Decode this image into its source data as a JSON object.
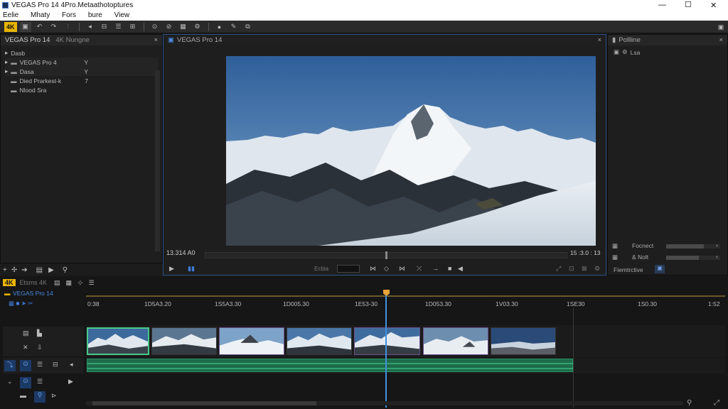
{
  "window": {
    "title": "VEGAS Pro 14  4Pro.Metaathotoptures",
    "controls": {
      "minimize": "—",
      "maximize": "☐",
      "close": "✕"
    }
  },
  "menu": [
    "Eelie",
    "Mhaty",
    "Fors",
    "bure",
    "View"
  ],
  "toolbar": {
    "badge_4k": "4K"
  },
  "explorer": {
    "tabs": [
      "VEGAS Pro 14",
      "4K Nungne"
    ],
    "close": "×",
    "root": "Dasb",
    "items": [
      {
        "label": "VEGAS Pro 4",
        "mark": "Y"
      },
      {
        "label": "Dasa",
        "mark": "Y"
      },
      {
        "label": "Died Prarkest-k",
        "mark": "7"
      },
      {
        "label": "Nlood Sra",
        "mark": ""
      }
    ]
  },
  "preview": {
    "title": "VEGAS Pro 14",
    "close": "×",
    "time_left": "13.314 A0",
    "time_right": "15 :3.0 : 13",
    "mode_label": "Ecbia"
  },
  "properties": {
    "title": "Pollline",
    "close": "×",
    "item": "Lsa",
    "sliders": [
      {
        "label": "Focnect",
        "value": 0.7
      },
      {
        "label": "& Nolt",
        "value": 0.6
      }
    ],
    "footer_label": "Fiemtrctive"
  },
  "timeline": {
    "badge_4k": "4K",
    "toolbar_label": "Etsms 4K",
    "project_label": "VEGAS Pro 14",
    "ruler": [
      "0:38",
      "1D5A3.20",
      "1S5A3.30",
      "1D005.30",
      "1E53-30",
      "1D053.30",
      "1V03.30",
      "1SE30",
      "1S0.30",
      "1:52"
    ],
    "playhead": 0.47,
    "clip_count": 7
  },
  "colors": {
    "accent": "#2f7ad8",
    "playhead": "#e8a33a",
    "audio": "#1e8a5c",
    "selected_clip": "#48c98a"
  }
}
